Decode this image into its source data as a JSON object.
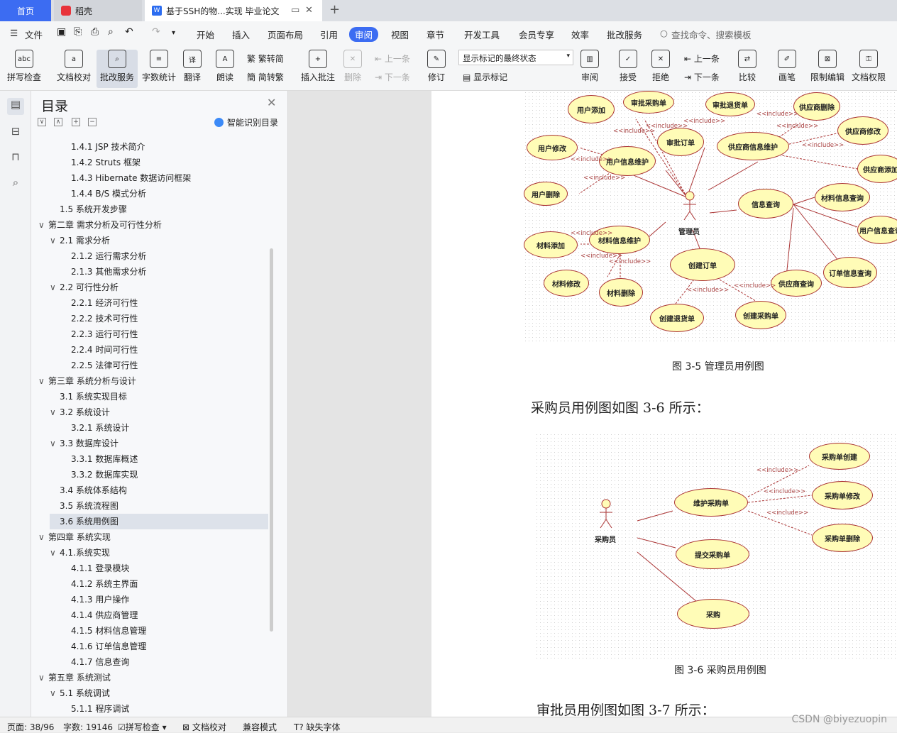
{
  "tabs": {
    "home": "首页",
    "daoke": "稻壳",
    "doc": "基于SSH的物...实现 毕业论文",
    "new_tab": "+"
  },
  "menu": {
    "file": "文件",
    "items": [
      "开始",
      "插入",
      "页面布局",
      "引用",
      "审阅",
      "视图",
      "章节",
      "开发工具",
      "会员专享",
      "效率",
      "批改服务"
    ],
    "search": "查找命令、搜索模板"
  },
  "ribbon": {
    "spell": "拼写检查",
    "doccheck": "文档校对",
    "correct": "批改服务",
    "wordcount": "字数统计",
    "translate": "翻译",
    "read": "朗读",
    "trad": "繁转简",
    "simp": "简转繁",
    "insert_comment": "插入批注",
    "delete": "删除",
    "prev1": "上一条",
    "next1": "下一条",
    "revise": "修订",
    "markup_state": "显示标记的最终状态",
    "show_markup": "显示标记",
    "review": "审阅",
    "accept": "接受",
    "reject": "拒绝",
    "prev2": "上一条",
    "next2": "下一条",
    "compare": "比较",
    "pen": "画笔",
    "restrict": "限制编辑",
    "perm": "文档权限"
  },
  "panel": {
    "title": "目录",
    "smart": "智能识别目录"
  },
  "toc": [
    {
      "t": "1.4.1 JSP 技术简介",
      "lvl": 3
    },
    {
      "t": "1.4.2 Struts  框架",
      "lvl": 3
    },
    {
      "t": "1.4.3 Hibernate 数据访问框架",
      "lvl": 3
    },
    {
      "t": "1.4.4    B/S 模式分析",
      "lvl": 3
    },
    {
      "t": "1.5  系统开发步骤",
      "lvl": 2
    },
    {
      "t": "第二章  需求分析及可行性分析",
      "lvl": 1,
      "open": true
    },
    {
      "t": "2.1 需求分析",
      "lvl": 2,
      "open": true
    },
    {
      "t": "2.1.2 运行需求分析",
      "lvl": 3
    },
    {
      "t": "2.1.3 其他需求分析",
      "lvl": 3
    },
    {
      "t": "2.2  可行性分析",
      "lvl": 2,
      "open": true
    },
    {
      "t": "2.2.1 经济可行性",
      "lvl": 3
    },
    {
      "t": "2.2.2 技术可行性",
      "lvl": 3
    },
    {
      "t": "2.2.3  运行可行性",
      "lvl": 3
    },
    {
      "t": "2.2.4 时间可行性",
      "lvl": 3
    },
    {
      "t": "2.2.5  法律可行性",
      "lvl": 3
    },
    {
      "t": "第三章  系统分析与设计",
      "lvl": 1,
      "open": true
    },
    {
      "t": "3.1 系统实现目标",
      "lvl": 2
    },
    {
      "t": "3.2  系统设计",
      "lvl": 2,
      "open": true
    },
    {
      "t": "3.2.1 系统设计",
      "lvl": 3
    },
    {
      "t": "3.3 数据库设计",
      "lvl": 2,
      "open": true
    },
    {
      "t": "3.3.1 数据库概述",
      "lvl": 3
    },
    {
      "t": "3.3.2 数据库实现",
      "lvl": 3
    },
    {
      "t": "3.4 系统体系结构",
      "lvl": 2
    },
    {
      "t": "3.5 系统流程图",
      "lvl": 2
    },
    {
      "t": "3.6 系统用例图",
      "lvl": 2,
      "sel": true
    },
    {
      "t": "第四章  系统实现",
      "lvl": 1,
      "open": true
    },
    {
      "t": "4.1.系统实现",
      "lvl": 2,
      "open": true
    },
    {
      "t": "4.1.1  登录模块",
      "lvl": 3
    },
    {
      "t": "4.1.2 系统主界面",
      "lvl": 3
    },
    {
      "t": "4.1.3 用户操作",
      "lvl": 3
    },
    {
      "t": "4.1.4 供应商管理",
      "lvl": 3
    },
    {
      "t": "4.1.5 材料信息管理",
      "lvl": 3
    },
    {
      "t": "4.1.6 订单信息管理",
      "lvl": 3
    },
    {
      "t": "4.1.7 信息查询",
      "lvl": 3
    },
    {
      "t": "第五章     系统测试",
      "lvl": 1,
      "open": true
    },
    {
      "t": "5.1 系统调试",
      "lvl": 2,
      "open": true
    },
    {
      "t": "5.1.1   程序调试",
      "lvl": 3
    }
  ],
  "doc": {
    "fig35_caption": "图 3-5  管理员用例图",
    "para36": "采购员用例图如图 3-6 所示：",
    "fig36_caption": "图 3-6  采购员用例图",
    "para37": "审批员用例图如图 3-7 所示：",
    "d1": {
      "actor": "管理员",
      "cases": [
        "用户添加",
        "审批采购单",
        "审批退货单",
        "供应商删除",
        "用户修改",
        "用户信息维护",
        "审批订单",
        "供应商信息维护",
        "供应商修改",
        "供应商添加",
        "用户删除",
        "材料信息查询",
        "信息查询",
        "用户信息查询",
        "材料添加",
        "材料信息维护",
        "创建订单",
        "订单信息查询",
        "材料修改",
        "材料删除",
        "供应商查询",
        "创建退货单",
        "创建采购单"
      ],
      "include": "<<include>>"
    },
    "d2": {
      "actor": "采购员",
      "cases": [
        "采购单创建",
        "维护采购单",
        "采购单修改",
        "采购单删除",
        "提交采购单",
        "采购"
      ],
      "include": "<<include>>"
    }
  },
  "status": {
    "page": "页面: 38/96",
    "words": "字数: 19146",
    "spell": "拼写检查",
    "doccheck": "文档校对",
    "compat": "兼容模式",
    "missing_font": "缺失字体"
  },
  "watermark": "CSDN @biyezuopin"
}
